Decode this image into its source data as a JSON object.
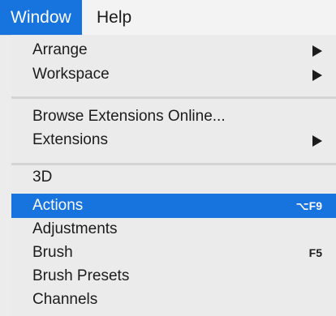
{
  "menubar": {
    "items": [
      {
        "label": "Window",
        "active": true
      },
      {
        "label": "Help",
        "active": false
      }
    ]
  },
  "menu": {
    "groups": [
      [
        {
          "label": "Arrange",
          "submenu": true
        },
        {
          "label": "Workspace",
          "submenu": true
        }
      ],
      [
        {
          "label": "Browse Extensions Online...",
          "submenu": false
        },
        {
          "label": "Extensions",
          "submenu": true
        }
      ],
      [
        {
          "label": "3D"
        },
        {
          "label": "Actions",
          "shortcut": "⌥F9",
          "highlighted": true
        },
        {
          "label": "Adjustments"
        },
        {
          "label": "Brush",
          "shortcut": "F5"
        },
        {
          "label": "Brush Presets"
        },
        {
          "label": "Channels"
        }
      ]
    ]
  },
  "colors": {
    "accent": "#1773de",
    "menu_bg": "#ebebeb",
    "separator": "#d4d4d4"
  }
}
